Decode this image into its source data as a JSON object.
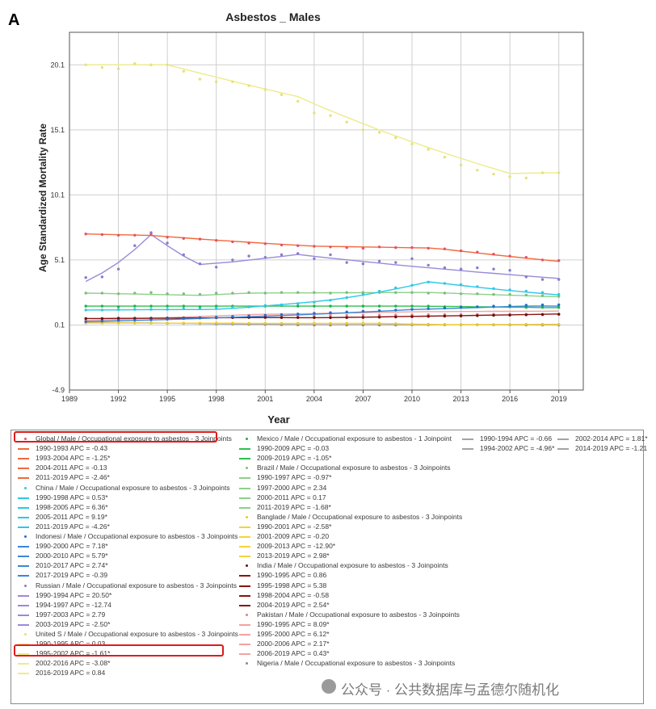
{
  "panel_label": "A",
  "chart_data": {
    "type": "line",
    "title": "Asbestos _ Males",
    "xlabel": "Year",
    "ylabel": "Age Standardized Mortality Rate",
    "x_ticks": [
      1989,
      1992,
      1995,
      1998,
      2001,
      2004,
      2007,
      2010,
      2013,
      2016,
      2019
    ],
    "y_ticks": [
      "-4.9",
      "0.1",
      "5.1",
      "10.1",
      "15.1",
      "20.1"
    ],
    "xlim": [
      1989,
      2020.5
    ],
    "ylim": [
      -4.9,
      22.6
    ],
    "grid": true,
    "years": [
      1990,
      1991,
      1992,
      1993,
      1994,
      1995,
      1996,
      1997,
      1998,
      1999,
      2000,
      2001,
      2002,
      2003,
      2004,
      2005,
      2006,
      2007,
      2008,
      2009,
      2010,
      2011,
      2012,
      2013,
      2014,
      2015,
      2016,
      2017,
      2018,
      2019
    ],
    "series": [
      {
        "name": "Global",
        "color": "#f06a3a",
        "marker": "#e8506a",
        "observed": [
          7.1,
          7.05,
          7.0,
          7.0,
          7.05,
          6.85,
          6.75,
          6.7,
          6.6,
          6.5,
          6.4,
          6.35,
          6.25,
          6.2,
          6.15,
          6.1,
          6.05,
          6.0,
          6.1,
          6.05,
          6.05,
          6.0,
          5.95,
          5.8,
          5.7,
          5.55,
          5.4,
          5.3,
          5.1,
          5.05
        ],
        "fitted": [
          7.1,
          7.07,
          7.04,
          7.01,
          6.98,
          6.89,
          6.8,
          6.71,
          6.62,
          6.54,
          6.46,
          6.38,
          6.3,
          6.23,
          6.16,
          6.14,
          6.12,
          6.1,
          6.08,
          6.06,
          6.04,
          6.02,
          5.92,
          5.78,
          5.64,
          5.5,
          5.37,
          5.24,
          5.11,
          4.99
        ]
      },
      {
        "name": "China",
        "color": "#2ec7e6",
        "marker": "#2ec7e6",
        "observed": [
          1.25,
          1.25,
          1.28,
          1.3,
          1.3,
          1.3,
          1.35,
          1.35,
          1.4,
          1.45,
          1.5,
          1.6,
          1.65,
          1.75,
          1.85,
          2.0,
          2.2,
          2.45,
          2.7,
          2.95,
          3.15,
          3.4,
          3.3,
          3.2,
          3.05,
          2.9,
          2.8,
          2.7,
          2.6,
          2.45
        ],
        "fitted": [
          1.25,
          1.26,
          1.26,
          1.27,
          1.28,
          1.28,
          1.29,
          1.29,
          1.3,
          1.38,
          1.47,
          1.57,
          1.67,
          1.78,
          1.89,
          2.02,
          2.2,
          2.4,
          2.63,
          2.87,
          3.13,
          3.42,
          3.28,
          3.14,
          3.0,
          2.87,
          2.75,
          2.63,
          2.52,
          2.41
        ]
      },
      {
        "name": "Indonesi",
        "color": "#3a87d8",
        "marker": "#1f6fd0",
        "observed": [
          0.35,
          0.4,
          0.45,
          0.48,
          0.5,
          0.55,
          0.6,
          0.65,
          0.7,
          0.75,
          0.8,
          0.85,
          0.9,
          0.95,
          1.0,
          1.05,
          1.1,
          1.15,
          1.2,
          1.25,
          1.3,
          1.35,
          1.4,
          1.45,
          1.5,
          1.55,
          1.6,
          1.62,
          1.64,
          1.65
        ],
        "fitted": [
          0.36,
          0.39,
          0.42,
          0.45,
          0.49,
          0.52,
          0.56,
          0.6,
          0.65,
          0.69,
          0.74,
          0.78,
          0.83,
          0.88,
          0.93,
          0.98,
          1.04,
          1.1,
          1.16,
          1.22,
          1.29,
          1.32,
          1.36,
          1.4,
          1.44,
          1.48,
          1.52,
          1.55,
          1.56,
          1.55
        ]
      },
      {
        "name": "Russian",
        "color": "#9b8ad8",
        "marker": "#8a7acb",
        "observed": [
          3.75,
          3.8,
          4.4,
          6.2,
          7.2,
          6.4,
          5.5,
          4.8,
          4.55,
          5.1,
          5.4,
          5.3,
          5.5,
          5.6,
          5.2,
          5.5,
          4.9,
          4.8,
          5.0,
          4.9,
          5.2,
          4.7,
          4.5,
          4.4,
          4.5,
          4.4,
          4.3,
          3.8,
          3.6,
          3.6
        ],
        "fitted": [
          3.45,
          4.1,
          4.9,
          5.9,
          7.05,
          6.2,
          5.4,
          4.75,
          4.85,
          4.95,
          5.09,
          5.23,
          5.37,
          5.52,
          5.38,
          5.24,
          5.11,
          4.98,
          4.86,
          4.73,
          4.61,
          4.5,
          4.39,
          4.28,
          4.17,
          4.07,
          3.97,
          3.87,
          3.77,
          3.68
        ]
      },
      {
        "name": "United S",
        "color": "#eeeb8a",
        "marker": "#e6e27a",
        "observed": [
          20.1,
          19.9,
          19.8,
          20.2,
          20.1,
          20.1,
          19.6,
          19.0,
          18.8,
          18.8,
          18.5,
          18.2,
          17.8,
          17.3,
          16.4,
          16.2,
          15.7,
          15.1,
          14.9,
          14.5,
          14.0,
          13.6,
          13.0,
          12.4,
          12.0,
          11.7,
          11.5,
          11.4,
          11.8,
          11.8
        ],
        "fitted": [
          20.1,
          20.1,
          20.1,
          20.1,
          20.1,
          20.1,
          19.78,
          19.46,
          19.15,
          18.84,
          18.54,
          18.24,
          17.95,
          17.66,
          17.1,
          16.58,
          16.07,
          15.57,
          15.09,
          14.63,
          14.18,
          13.74,
          13.32,
          12.91,
          12.51,
          12.13,
          11.75,
          11.77,
          11.79,
          11.8
        ]
      },
      {
        "name": "Mexico",
        "color": "#2fbf4f",
        "marker": "#1fb04a",
        "observed": [
          1.55,
          1.55,
          1.5,
          1.55,
          1.55,
          1.55,
          1.55,
          1.5,
          1.55,
          1.55,
          1.5,
          1.55,
          1.6,
          1.55,
          1.55,
          1.55,
          1.55,
          1.55,
          1.55,
          1.55,
          1.55,
          1.55,
          1.5,
          1.5,
          1.5,
          1.5,
          1.5,
          1.45,
          1.45,
          1.45
        ],
        "fitted": [
          1.55,
          1.55,
          1.55,
          1.55,
          1.55,
          1.55,
          1.55,
          1.55,
          1.55,
          1.55,
          1.55,
          1.55,
          1.55,
          1.55,
          1.55,
          1.55,
          1.55,
          1.55,
          1.55,
          1.55,
          1.55,
          1.54,
          1.53,
          1.52,
          1.5,
          1.49,
          1.47,
          1.46,
          1.44,
          1.43
        ]
      },
      {
        "name": "Brazil",
        "color": "#8fcf8a",
        "marker": "#7abf7a",
        "observed": [
          2.55,
          2.55,
          2.5,
          2.55,
          2.6,
          2.5,
          2.5,
          2.45,
          2.55,
          2.55,
          2.6,
          2.55,
          2.6,
          2.6,
          2.6,
          2.55,
          2.6,
          2.6,
          2.6,
          2.6,
          2.6,
          2.55,
          2.55,
          2.5,
          2.5,
          2.45,
          2.45,
          2.4,
          2.35,
          2.3
        ],
        "fitted": [
          2.55,
          2.53,
          2.5,
          2.48,
          2.45,
          2.43,
          2.4,
          2.38,
          2.44,
          2.5,
          2.55,
          2.56,
          2.56,
          2.57,
          2.57,
          2.58,
          2.58,
          2.58,
          2.59,
          2.59,
          2.6,
          2.6,
          2.56,
          2.51,
          2.47,
          2.43,
          2.39,
          2.35,
          2.31,
          2.27
        ]
      },
      {
        "name": "Banglade",
        "color": "#f5d33a",
        "marker": "#f0c820",
        "observed": [
          0.25,
          0.25,
          0.25,
          0.25,
          0.25,
          0.24,
          0.24,
          0.24,
          0.24,
          0.24,
          0.23,
          0.23,
          0.23,
          0.23,
          0.23,
          0.22,
          0.22,
          0.22,
          0.22,
          0.2,
          0.18,
          0.16,
          0.15,
          0.13,
          0.13,
          0.14,
          0.14,
          0.15,
          0.15,
          0.15
        ],
        "fitted": [
          0.25,
          0.25,
          0.25,
          0.25,
          0.24,
          0.24,
          0.24,
          0.24,
          0.24,
          0.24,
          0.23,
          0.23,
          0.23,
          0.23,
          0.23,
          0.23,
          0.22,
          0.22,
          0.22,
          0.2,
          0.17,
          0.15,
          0.13,
          0.13,
          0.13,
          0.14,
          0.14,
          0.14,
          0.15,
          0.15
        ]
      },
      {
        "name": "India",
        "color": "#8a1212",
        "marker": "#6a0c0c",
        "observed": [
          0.6,
          0.6,
          0.62,
          0.62,
          0.62,
          0.63,
          0.64,
          0.65,
          0.66,
          0.67,
          0.68,
          0.68,
          0.67,
          0.67,
          0.67,
          0.66,
          0.67,
          0.68,
          0.7,
          0.72,
          0.74,
          0.76,
          0.78,
          0.8,
          0.82,
          0.84,
          0.86,
          0.88,
          0.9,
          0.92
        ],
        "fitted": [
          0.6,
          0.6,
          0.61,
          0.61,
          0.62,
          0.62,
          0.64,
          0.65,
          0.66,
          0.66,
          0.67,
          0.67,
          0.67,
          0.66,
          0.66,
          0.67,
          0.69,
          0.7,
          0.72,
          0.74,
          0.76,
          0.78,
          0.8,
          0.82,
          0.84,
          0.86,
          0.88,
          0.9,
          0.92,
          0.95
        ]
      },
      {
        "name": "Pakistan",
        "color": "#f0a3a3",
        "marker": "#e87c7c",
        "observed": [
          0.45,
          0.47,
          0.5,
          0.53,
          0.56,
          0.6,
          0.63,
          0.66,
          0.7,
          0.73,
          0.76,
          0.78,
          0.79,
          0.8,
          0.82,
          0.83,
          0.84,
          0.85,
          0.86,
          0.87,
          0.88,
          0.89,
          0.9,
          0.9,
          0.91,
          0.92,
          0.92,
          0.93,
          0.93,
          0.94
        ],
        "fitted": [
          0.45,
          0.49,
          0.53,
          0.57,
          0.62,
          0.67,
          0.71,
          0.76,
          0.8,
          0.85,
          0.9,
          0.92,
          0.94,
          0.96,
          0.98,
          1.0,
          1.02,
          1.04,
          1.07,
          1.09,
          1.11,
          1.13,
          1.13,
          1.14,
          1.14,
          1.15,
          1.15,
          1.16,
          1.16,
          1.17
        ]
      },
      {
        "name": "Nigeria",
        "color": "#a3a3a3",
        "marker": "#8a8a8a",
        "observed": [
          0.3,
          0.29,
          0.28,
          0.27,
          0.26,
          0.23,
          0.22,
          0.2,
          0.18,
          0.17,
          0.15,
          0.14,
          0.12,
          0.11,
          0.1,
          0.1,
          0.1,
          0.1,
          0.1,
          0.1,
          0.11,
          0.11,
          0.11,
          0.11,
          0.11,
          0.11,
          0.11,
          0.1,
          0.1,
          0.1
        ],
        "fitted": [
          0.3,
          0.29,
          0.28,
          0.27,
          0.26,
          0.24,
          0.23,
          0.21,
          0.19,
          0.18,
          0.16,
          0.15,
          0.13,
          0.12,
          0.12,
          0.11,
          0.11,
          0.11,
          0.11,
          0.11,
          0.11,
          0.11,
          0.11,
          0.12,
          0.12,
          0.12,
          0.11,
          0.11,
          0.11,
          0.11
        ]
      }
    ]
  },
  "legend": {
    "col1": [
      {
        "kind": "marker",
        "color": "#e8506a",
        "text": "Global / Male / Occupational exposure to asbestos - 3 Joinpoints"
      },
      {
        "kind": "line",
        "color": "#f06a3a",
        "text": "1990-1993 APC = -0.43"
      },
      {
        "kind": "line",
        "color": "#f06a3a",
        "text": "1993-2004 APC = -1.25*"
      },
      {
        "kind": "line",
        "color": "#f06a3a",
        "text": "2004-2011 APC = -0.13"
      },
      {
        "kind": "line",
        "color": "#f06a3a",
        "text": "2011-2019 APC = -2.46*"
      },
      {
        "kind": "marker",
        "color": "#2ec7e6",
        "text": "China / Male / Occupational exposure to asbestos - 3 Joinpoints"
      },
      {
        "kind": "line",
        "color": "#2ec7e6",
        "text": "1990-1998 APC = 0.53*"
      },
      {
        "kind": "line",
        "color": "#2ec7e6",
        "text": "1998-2005 APC = 6.36*"
      },
      {
        "kind": "line",
        "color": "#2ec7e6",
        "text": "2005-2011 APC = 9.19*"
      },
      {
        "kind": "line",
        "color": "#2ec7e6",
        "text": "2011-2019 APC = -4.26*"
      },
      {
        "kind": "marker",
        "color": "#1f6fd0",
        "text": "Indonesi / Male / Occupational exposure to asbestos - 3 Joinpoints"
      },
      {
        "kind": "line",
        "color": "#3a87d8",
        "text": "1990-2000 APC = 7.18*"
      },
      {
        "kind": "line",
        "color": "#3a87d8",
        "text": "2000-2010 APC = 5.79*"
      },
      {
        "kind": "line",
        "color": "#3a87d8",
        "text": "2010-2017 APC = 2.74*"
      },
      {
        "kind": "line",
        "color": "#3a87d8",
        "text": "2017-2019 APC = -0.39"
      },
      {
        "kind": "marker",
        "color": "#8a7acb",
        "text": "Russian / Male / Occupational exposure to asbestos - 3 Joinpoints"
      },
      {
        "kind": "line",
        "color": "#9b8ad8",
        "text": "1990-1994 APC = 20.50*"
      },
      {
        "kind": "line",
        "color": "#9b8ad8",
        "text": "1994-1997 APC = -12.74"
      },
      {
        "kind": "line",
        "color": "#9b8ad8",
        "text": "1997-2003 APC = 2.79"
      },
      {
        "kind": "line",
        "color": "#9b8ad8",
        "text": "2003-2019 APC = -2.50*"
      },
      {
        "kind": "marker",
        "color": "#e6e27a",
        "text": "United S / Male / Occupational exposure to asbestos - 3 Joinpoints"
      },
      {
        "kind": "line",
        "color": "#eeeb8a",
        "text": "1990-1995 APC = 0.03"
      },
      {
        "kind": "line",
        "color": "#eeeb8a",
        "text": "1995-2002 APC = -1.61*"
      },
      {
        "kind": "line",
        "color": "#eeeb8a",
        "text": "2002-2016 APC = -3.08*"
      },
      {
        "kind": "line",
        "color": "#eeeb8a",
        "text": "2016-2019 APC = 0.84"
      }
    ],
    "col2": [
      {
        "kind": "marker",
        "color": "#1fb04a",
        "text": "Mexico / Male / Occupational exposure to asbestos - 1 Joinpoint"
      },
      {
        "kind": "line",
        "color": "#2fbf4f",
        "text": "1990-2009 APC = -0.03"
      },
      {
        "kind": "line",
        "color": "#2fbf4f",
        "text": "2009-2019 APC = -1.05*"
      },
      {
        "kind": "marker",
        "color": "#7abf7a",
        "text": "Brazil / Male / Occupational exposure to asbestos - 3 Joinpoints"
      },
      {
        "kind": "line",
        "color": "#8fcf8a",
        "text": "1990-1997 APC = -0.97*"
      },
      {
        "kind": "line",
        "color": "#8fcf8a",
        "text": "1997-2000 APC = 2.34"
      },
      {
        "kind": "line",
        "color": "#8fcf8a",
        "text": "2000-2011 APC = 0.17"
      },
      {
        "kind": "line",
        "color": "#8fcf8a",
        "text": "2011-2019 APC = -1.68*"
      },
      {
        "kind": "marker",
        "color": "#f0c820",
        "text": "Banglade / Male / Occupational exposure to asbestos - 3 Joinpoints"
      },
      {
        "kind": "line",
        "color": "#f5d33a",
        "text": "1990-2001 APC = -2.58*"
      },
      {
        "kind": "line",
        "color": "#f5d33a",
        "text": "2001-2009 APC = -0.20"
      },
      {
        "kind": "line",
        "color": "#f5d33a",
        "text": "2009-2013 APC = -12.90*"
      },
      {
        "kind": "line",
        "color": "#f5d33a",
        "text": "2013-2019 APC = 2.98*"
      },
      {
        "kind": "marker",
        "color": "#6a0c0c",
        "text": "India / Male / Occupational exposure to asbestos - 3 Joinpoints"
      },
      {
        "kind": "line",
        "color": "#8a1212",
        "text": "1990-1995 APC = 0.86"
      },
      {
        "kind": "line",
        "color": "#8a1212",
        "text": "1995-1998 APC = 5.38"
      },
      {
        "kind": "line",
        "color": "#8a1212",
        "text": "1998-2004 APC = -0.58"
      },
      {
        "kind": "line",
        "color": "#8a1212",
        "text": "2004-2019 APC = 2.54*"
      },
      {
        "kind": "marker",
        "color": "#e87c7c",
        "text": "Pakistan / Male / Occupational exposure to asbestos - 3 Joinpoints"
      },
      {
        "kind": "line",
        "color": "#f0a3a3",
        "text": "1990-1995 APC = 8.09*"
      },
      {
        "kind": "line",
        "color": "#f0a3a3",
        "text": "1995-2000 APC = 6.12*"
      },
      {
        "kind": "line",
        "color": "#f0a3a3",
        "text": "2000-2006 APC = 2.17*"
      },
      {
        "kind": "line",
        "color": "#f0a3a3",
        "text": "2006-2019 APC = 0.43*"
      },
      {
        "kind": "marker",
        "color": "#8a8a8a",
        "text": "Nigeria / Male / Occupational exposure to asbestos - 3 Joinpoints"
      }
    ],
    "col3": [
      {
        "kind": "line",
        "color": "#a3a3a3",
        "text": "1990-1994 APC = -0.66"
      },
      {
        "kind": "line",
        "color": "#a3a3a3",
        "text": "1994-2002 APC = -4.96*"
      }
    ],
    "col4": [
      {
        "kind": "line",
        "color": "#a3a3a3",
        "text": "2002-2014 APC = 1.81*"
      },
      {
        "kind": "line",
        "color": "#a3a3a3",
        "text": "2014-2019 APC = -1.21"
      }
    ]
  },
  "watermark": "公众号 · 公共数据库与孟德尔随机化"
}
